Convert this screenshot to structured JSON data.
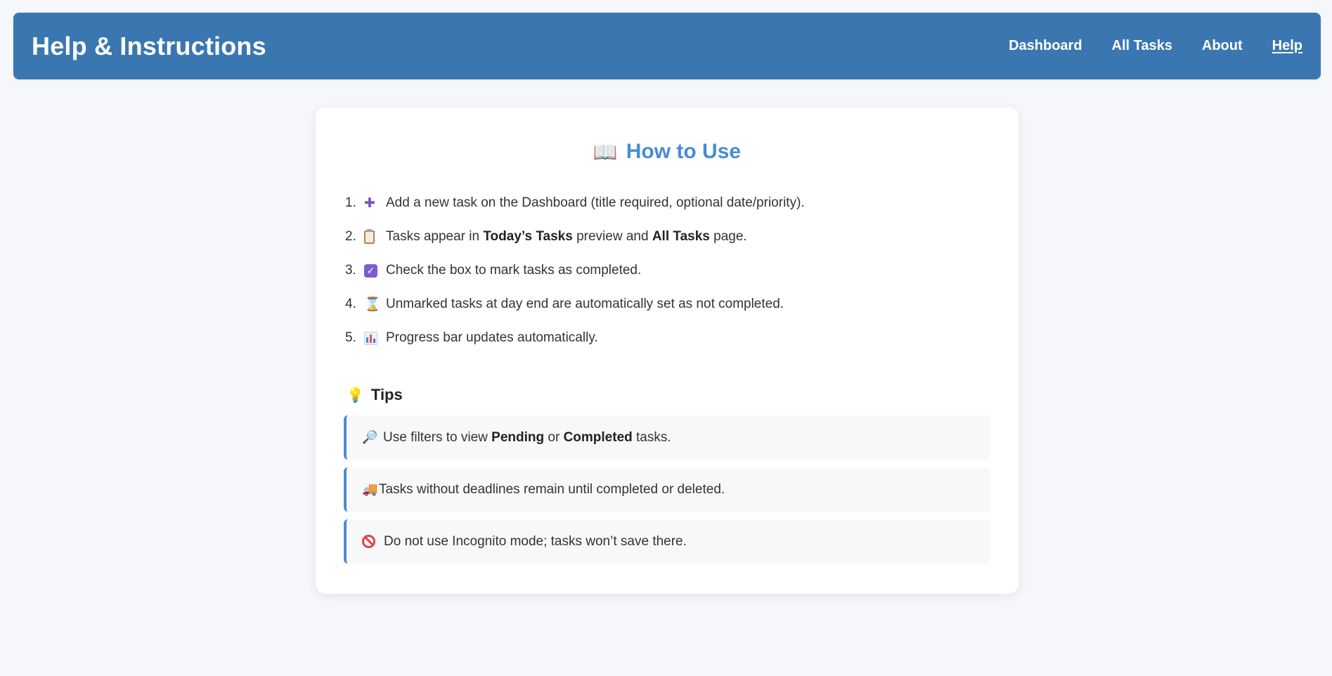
{
  "header": {
    "title": "Help & Instructions",
    "nav": [
      {
        "label": "Dashboard",
        "active": false
      },
      {
        "label": "All Tasks",
        "active": false
      },
      {
        "label": "About",
        "active": false
      },
      {
        "label": "Help",
        "active": true
      }
    ]
  },
  "card": {
    "title": "How to Use",
    "steps": [
      {
        "num": "1.",
        "icon": "plus-icon",
        "parts": [
          "Add a new task on the Dashboard (title required, optional date/priority)."
        ]
      },
      {
        "num": "2.",
        "icon": "clipboard-icon",
        "parts": [
          "Tasks appear in ",
          "Today’s Tasks",
          " preview and ",
          "All Tasks",
          " page."
        ]
      },
      {
        "num": "3.",
        "icon": "checkbox-icon",
        "parts": [
          "Check the box to mark tasks as completed."
        ]
      },
      {
        "num": "4.",
        "icon": "hourglass-icon",
        "parts": [
          "Unmarked tasks at day end are automatically set as not completed."
        ]
      },
      {
        "num": "5.",
        "icon": "bar-chart-icon",
        "parts": [
          "Progress bar updates automatically."
        ]
      }
    ],
    "tips_heading": "Tips",
    "tips": [
      {
        "icon": "magnifier-icon",
        "parts": [
          "Use filters to view ",
          "Pending",
          " or ",
          "Completed",
          " tasks."
        ]
      },
      {
        "icon": "truck-icon",
        "parts": [
          "Tasks without deadlines remain until completed or deleted."
        ]
      },
      {
        "icon": "no-entry-icon",
        "parts": [
          "Do not use Incognito mode; tasks won’t save there."
        ]
      }
    ]
  },
  "colors": {
    "header_bg": "#3a77b0",
    "page_bg": "#f5f7fb",
    "accent": "#4a8bd6",
    "tip_bg": "#f8f8f8"
  }
}
